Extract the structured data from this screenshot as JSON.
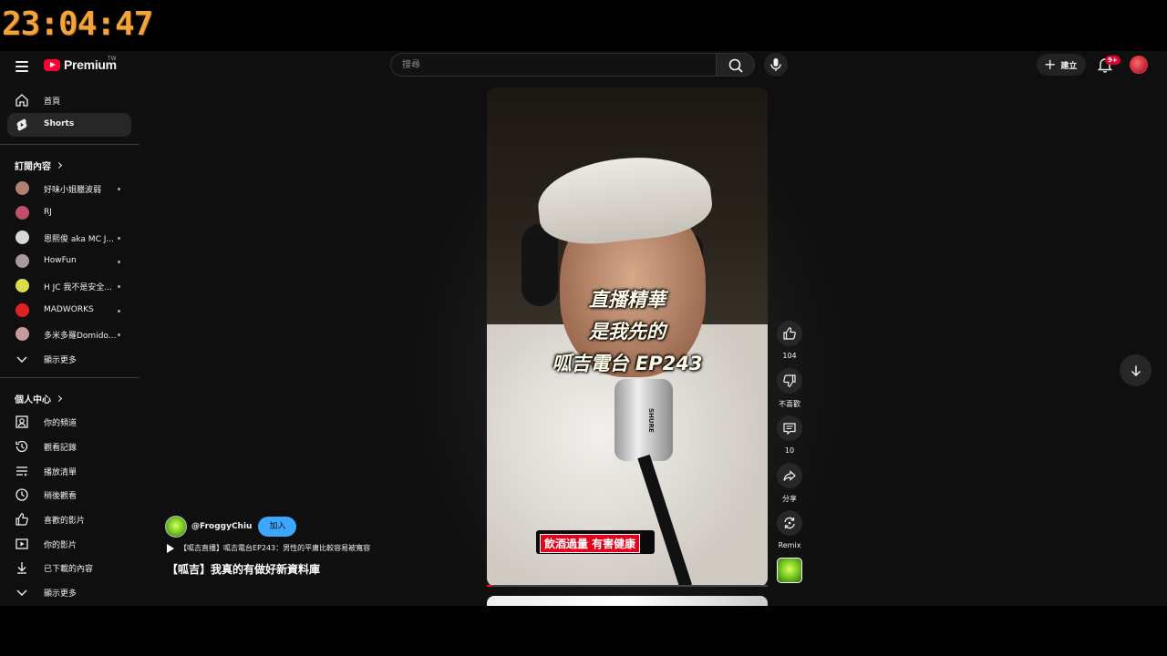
{
  "clock": "23:04:47",
  "header": {
    "logo_text": "Premium",
    "logo_region": "TW",
    "search_placeholder": "搜尋",
    "create_label": "建立",
    "notification_badge": "9+"
  },
  "sidebar": {
    "main": [
      {
        "label": "首頁",
        "icon": "home-icon"
      },
      {
        "label": "Shorts",
        "icon": "shorts-icon",
        "active": true
      }
    ],
    "subscriptions_title": "訂閱內容",
    "subscriptions": [
      {
        "label": "好味小姐臘波弱",
        "color": "#b08070"
      },
      {
        "label": "RJ",
        "color": "#c0506a"
      },
      {
        "label": "恩熙俊 aka MC J...",
        "color": "#d8d8d8"
      },
      {
        "label": "HowFun",
        "color": "#a89aa0"
      },
      {
        "label": "H JC 我不是安全...",
        "color": "#d7e04a"
      },
      {
        "label": "MADWORKS",
        "color": "#e02222"
      },
      {
        "label": "多米多羅Domido...",
        "color": "#c89a9a"
      }
    ],
    "show_more_1": "顯示更多",
    "you_title": "個人中心",
    "you_items": [
      {
        "label": "你的頻道",
        "icon": "channel-icon"
      },
      {
        "label": "觀看記錄",
        "icon": "history-icon"
      },
      {
        "label": "播放清單",
        "icon": "playlist-icon"
      },
      {
        "label": "稍後觀看",
        "icon": "clock-icon"
      },
      {
        "label": "喜歡的影片",
        "icon": "thumbs-up-icon"
      },
      {
        "label": "你的影片",
        "icon": "video-icon"
      },
      {
        "label": "已下載的內容",
        "icon": "download-icon"
      }
    ],
    "show_more_2": "顯示更多"
  },
  "short": {
    "overlay_lines": [
      "直播精華",
      "是我先的",
      "呱吉電台 EP243"
    ],
    "warning": "飲酒過量 有害健康",
    "mic_brand": "SHURE",
    "progress": 0.02,
    "channel": "@FroggyChiu",
    "join_label": "加入",
    "related_video": "【呱吉直播】呱吉電台EP243：男性的平庸比較容易被寬容",
    "title": "【呱吉】我真的有做好新資料庫",
    "actions": {
      "like_count": "104",
      "dislike_label": "不喜歡",
      "comment_count": "10",
      "share_label": "分享",
      "remix_label": "Remix"
    }
  },
  "colors": {
    "accent": "#ff0033",
    "join": "#3ea6ff",
    "clock": "#f2a33a"
  }
}
